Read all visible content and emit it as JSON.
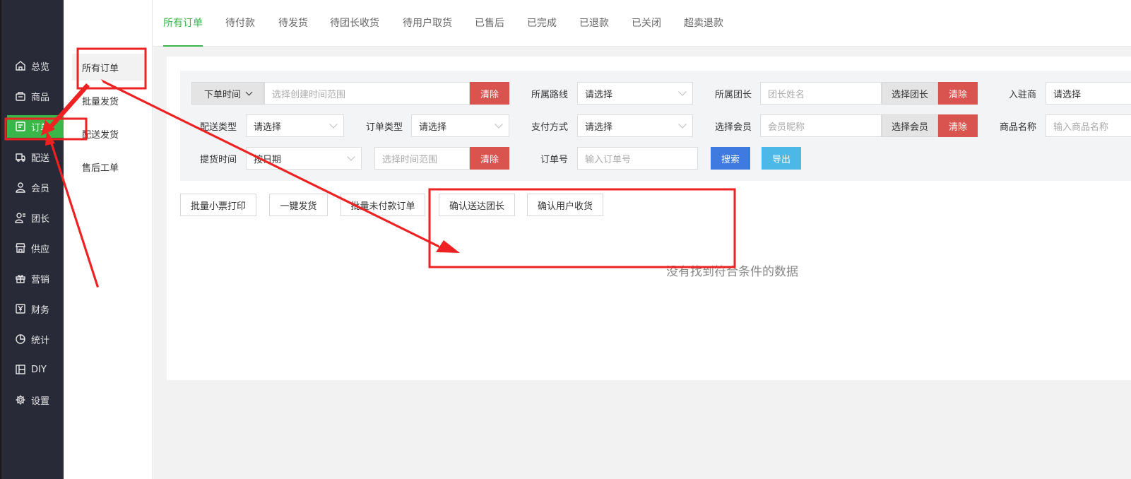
{
  "sidebar": {
    "items": [
      {
        "label": "总览",
        "icon": "home-icon"
      },
      {
        "label": "商品",
        "icon": "bag-icon"
      },
      {
        "label": "订单",
        "icon": "order-icon"
      },
      {
        "label": "配送",
        "icon": "delivery-icon"
      },
      {
        "label": "会员",
        "icon": "user-icon"
      },
      {
        "label": "团长",
        "icon": "leader-icon"
      },
      {
        "label": "供应",
        "icon": "store-icon"
      },
      {
        "label": "营销",
        "icon": "gift-icon"
      },
      {
        "label": "财务",
        "icon": "yen-icon"
      },
      {
        "label": "统计",
        "icon": "pie-icon"
      },
      {
        "label": "DIY",
        "icon": "layout-icon"
      },
      {
        "label": "设置",
        "icon": "gear-icon"
      }
    ],
    "active_color": "#3ab54a"
  },
  "submenu": {
    "items": [
      "所有订单",
      "批量发货",
      "配送发货",
      "售后工单"
    ]
  },
  "tabs": [
    "所有订单",
    "待付款",
    "待发货",
    "待团长收货",
    "待用户取货",
    "已售后",
    "已完成",
    "已退款",
    "已关闭",
    "超卖退款"
  ],
  "filter": {
    "order_time_select": "下单时间",
    "create_time_placeholder": "选择创建时间范围",
    "clear": "清除",
    "route_label": "所属路线",
    "route_value": "请选择",
    "leader_label": "所属团长",
    "leader_placeholder": "团长姓名",
    "choose_leader": "选择团长",
    "merchant_label": "入驻商",
    "merchant_value": "请选择",
    "delivery_type_label": "配送类型",
    "delivery_type_value": "请选择",
    "order_type_label": "订单类型",
    "order_type_value": "请选择",
    "pay_method_label": "支付方式",
    "pay_method_value": "请选择",
    "member_label": "选择会员",
    "member_placeholder": "会员昵称",
    "choose_member": "选择会员",
    "goods_name_label": "商品名称",
    "goods_name_placeholder": "输入商品名称",
    "pickup_time_label": "提货时间",
    "pickup_date_value": "按日期",
    "pickup_range_placeholder": "选择时间范围",
    "order_no_label": "订单号",
    "order_no_placeholder": "输入订单号",
    "search": "搜索",
    "export": "导出"
  },
  "actions": [
    "批量小票打印",
    "一键发货",
    "批量未付款订单",
    "确认送达团长",
    "确认用户收货"
  ],
  "empty_text": "没有找到符合条件的数据",
  "annotation_color": "#ee2222"
}
